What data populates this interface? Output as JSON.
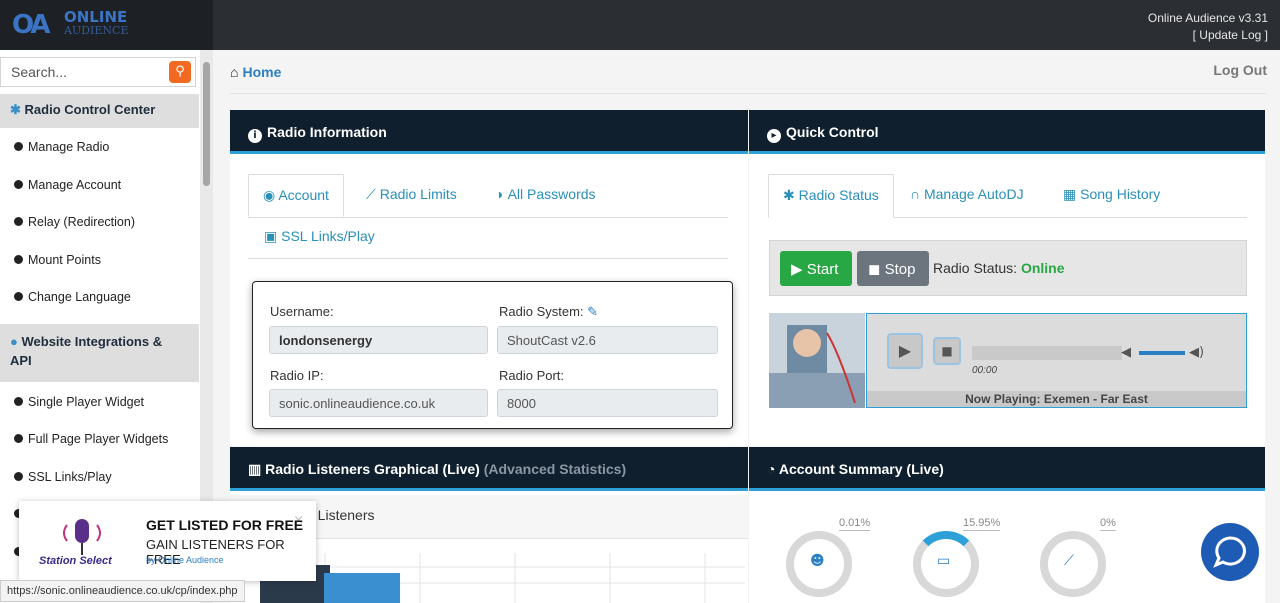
{
  "header": {
    "logo_mark": "OA",
    "logo_text": "ONLINE",
    "logo_sub": "AUDIENCE",
    "version": "Online Audience v3.31",
    "update_log": "[ Update Log ]"
  },
  "sidebar": {
    "search_placeholder": "Search...",
    "section1": "Radio Control Center",
    "items1": [
      "Manage Radio",
      "Manage Account",
      "Relay (Redirection)",
      "Mount Points",
      "Change Language"
    ],
    "section2_line1": "Website Integrations &",
    "section2_line2": "API",
    "items2": [
      "Single Player Widget",
      "Full Page Player Widgets",
      "SSL Links/Play"
    ]
  },
  "breadcrumb": {
    "home": "Home"
  },
  "logout": "Log Out",
  "radio_info": {
    "title": "Radio Information",
    "tabs": [
      "Account",
      "Radio Limits",
      "All Passwords",
      "SSL Links/Play"
    ],
    "fields": {
      "username_label": "Username:",
      "username": "londonsenergy",
      "system_label": "Radio System:",
      "system": "ShoutCast v2.6",
      "ip_label": "Radio IP:",
      "ip": "sonic.onlineaudience.co.uk",
      "port_label": "Radio Port:",
      "port": "8000"
    }
  },
  "quick_control": {
    "title": "Quick Control",
    "tabs": [
      "Radio Status",
      "Manage AutoDJ",
      "Song History"
    ],
    "start": "Start",
    "stop": "Stop",
    "status_label": "Radio Status:",
    "status_value": "Online",
    "time": "00:00",
    "now_playing": "Now Playing: Exemen - Far East"
  },
  "listeners": {
    "title": "Radio Listeners Graphical (Live)",
    "title_muted": "(Advanced Statistics)",
    "subtitle": "p Listeners"
  },
  "summary": {
    "title": "Account Summary (Live)",
    "pcts": [
      "0.01%",
      "15.95%",
      "0%"
    ]
  },
  "promo": {
    "title": "GET LISTED FOR FREE",
    "subtitle": "GAIN LISTENERS FOR FREE",
    "by": "by Online Audience",
    "brand": "Station Select",
    "close": "×"
  },
  "status_url": "https://sonic.onlineaudience.co.uk/cp/index.php",
  "colors": {
    "accent": "#2ea0d8",
    "start": "#28a745",
    "stop": "#6c757d",
    "header": "#0f1f2e"
  }
}
